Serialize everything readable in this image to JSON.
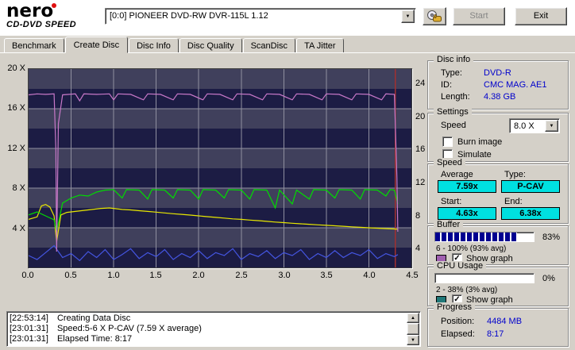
{
  "header": {
    "logo_line1": "nero",
    "logo_line2": "CD-DVD SPEED",
    "device_selector": "[0:0] PIONEER DVD-RW DVR-115L 1.12",
    "start_label": "Start",
    "exit_label": "Exit"
  },
  "tabs": [
    {
      "label": "Benchmark"
    },
    {
      "label": "Create Disc"
    },
    {
      "label": "Disc Info"
    },
    {
      "label": "Disc Quality"
    },
    {
      "label": "ScanDisc"
    },
    {
      "label": "TA Jitter"
    }
  ],
  "chart": {
    "type": "line",
    "x_max": 4.5,
    "y_max": 20,
    "x_ticks": [
      "0.0",
      "0.5",
      "1.0",
      "1.5",
      "2.0",
      "2.5",
      "3.0",
      "3.5",
      "4.0",
      "4.5"
    ],
    "y_left_ticks": [
      "20 X",
      "16 X",
      "12 X",
      "8 X",
      "4 X"
    ],
    "y_right_ticks": [
      "24",
      "20",
      "16",
      "12",
      "8",
      "4"
    ],
    "end_marker_x": 4.31,
    "colors": {
      "band_light": "#40405c",
      "band_dark": "#1c1c44",
      "grid": "#9090a0",
      "marker": "#a03030",
      "buffer": "#c878c8",
      "rpm": "#e8e800",
      "write": "#00dc00",
      "cpu": "#4455e0"
    },
    "series": {
      "buffer": [
        [
          0,
          17.4
        ],
        [
          0.1,
          17.5
        ],
        [
          0.2,
          17.45
        ],
        [
          0.3,
          17.5
        ],
        [
          0.32,
          12
        ],
        [
          0.33,
          1.6
        ],
        [
          0.35,
          14.5
        ],
        [
          0.4,
          17.4
        ],
        [
          0.55,
          17.5
        ],
        [
          0.6,
          16.8
        ],
        [
          0.65,
          17.5
        ],
        [
          0.8,
          17.45
        ],
        [
          0.95,
          17.5
        ],
        [
          1.0,
          16.9
        ],
        [
          1.05,
          17.5
        ],
        [
          1.2,
          17.45
        ],
        [
          1.35,
          16.9
        ],
        [
          1.4,
          17.5
        ],
        [
          1.55,
          17.45
        ],
        [
          1.7,
          16.9
        ],
        [
          1.75,
          17.5
        ],
        [
          1.9,
          17.45
        ],
        [
          2.05,
          16.9
        ],
        [
          2.1,
          17.5
        ],
        [
          2.25,
          17.45
        ],
        [
          2.4,
          16.9
        ],
        [
          2.45,
          17.5
        ],
        [
          2.6,
          17.45
        ],
        [
          2.75,
          16.9
        ],
        [
          2.8,
          17.5
        ],
        [
          2.95,
          17.45
        ],
        [
          3.1,
          16.9
        ],
        [
          3.15,
          17.5
        ],
        [
          3.3,
          17.45
        ],
        [
          3.45,
          16.9
        ],
        [
          3.5,
          17.5
        ],
        [
          3.65,
          17.45
        ],
        [
          3.8,
          16.9
        ],
        [
          3.85,
          17.5
        ],
        [
          4.0,
          17.45
        ],
        [
          4.15,
          16.9
        ],
        [
          4.2,
          17.5
        ],
        [
          4.3,
          17.45
        ],
        [
          4.33,
          9.0
        ],
        [
          4.34,
          3.6
        ]
      ],
      "write": [
        [
          0,
          5.3
        ],
        [
          0.1,
          5.6
        ],
        [
          0.2,
          5.2
        ],
        [
          0.3,
          4.8
        ],
        [
          0.33,
          3.6
        ],
        [
          0.4,
          6.5
        ],
        [
          0.5,
          7.0
        ],
        [
          0.6,
          7.3
        ],
        [
          0.7,
          7.2
        ],
        [
          0.8,
          7.6
        ],
        [
          0.9,
          7.8
        ],
        [
          1.0,
          7.85
        ],
        [
          1.1,
          7.0
        ],
        [
          1.15,
          7.85
        ],
        [
          1.3,
          7.8
        ],
        [
          1.4,
          6.9
        ],
        [
          1.45,
          7.85
        ],
        [
          1.6,
          7.8
        ],
        [
          1.7,
          7.0
        ],
        [
          1.75,
          7.85
        ],
        [
          1.9,
          7.8
        ],
        [
          2.0,
          6.9
        ],
        [
          2.05,
          7.85
        ],
        [
          2.2,
          7.8
        ],
        [
          2.3,
          7.0
        ],
        [
          2.35,
          7.85
        ],
        [
          2.5,
          7.8
        ],
        [
          2.6,
          6.9
        ],
        [
          2.65,
          7.85
        ],
        [
          2.8,
          7.8
        ],
        [
          2.9,
          6.0
        ],
        [
          2.95,
          7.8
        ],
        [
          3.1,
          6.4
        ],
        [
          3.15,
          7.8
        ],
        [
          3.3,
          6.9
        ],
        [
          3.35,
          7.85
        ],
        [
          3.5,
          7.8
        ],
        [
          3.6,
          7.0
        ],
        [
          3.65,
          7.85
        ],
        [
          3.8,
          7.8
        ],
        [
          3.9,
          6.9
        ],
        [
          3.95,
          7.85
        ],
        [
          4.1,
          7.8
        ],
        [
          4.2,
          7.2
        ],
        [
          4.25,
          7.85
        ],
        [
          4.3,
          7.8
        ],
        [
          4.34,
          6.4
        ]
      ],
      "rpm": [
        [
          0,
          4.85
        ],
        [
          0.1,
          5.1
        ],
        [
          0.15,
          6.2
        ],
        [
          0.2,
          6.35
        ],
        [
          0.25,
          6.1
        ],
        [
          0.3,
          5.2
        ],
        [
          0.33,
          2.6
        ],
        [
          0.38,
          5.3
        ],
        [
          0.45,
          5.55
        ],
        [
          0.55,
          5.65
        ],
        [
          0.65,
          5.75
        ],
        [
          0.75,
          5.85
        ],
        [
          0.85,
          5.95
        ],
        [
          0.95,
          6.0
        ],
        [
          1.0,
          5.95
        ],
        [
          1.1,
          5.85
        ],
        [
          1.2,
          5.8
        ],
        [
          1.3,
          5.72
        ],
        [
          1.4,
          5.65
        ],
        [
          1.5,
          5.58
        ],
        [
          1.6,
          5.5
        ],
        [
          1.7,
          5.42
        ],
        [
          1.8,
          5.35
        ],
        [
          1.9,
          5.28
        ],
        [
          2.0,
          5.2
        ],
        [
          2.1,
          5.12
        ],
        [
          2.2,
          5.05
        ],
        [
          2.3,
          4.98
        ],
        [
          2.4,
          4.9
        ],
        [
          2.5,
          4.85
        ],
        [
          2.6,
          4.78
        ],
        [
          2.7,
          4.72
        ],
        [
          2.8,
          4.65
        ],
        [
          2.9,
          4.58
        ],
        [
          3.0,
          4.52
        ],
        [
          3.1,
          4.46
        ],
        [
          3.2,
          4.4
        ],
        [
          3.3,
          4.35
        ],
        [
          3.4,
          4.3
        ],
        [
          3.5,
          4.25
        ],
        [
          3.6,
          4.2
        ],
        [
          3.7,
          4.15
        ],
        [
          3.8,
          4.1
        ],
        [
          3.9,
          4.05
        ],
        [
          4.0,
          4.0
        ],
        [
          4.1,
          3.96
        ],
        [
          4.2,
          3.92
        ],
        [
          4.3,
          3.88
        ],
        [
          4.34,
          3.85
        ]
      ],
      "cpu": [
        [
          0,
          1.2
        ],
        [
          0.1,
          0.8
        ],
        [
          0.2,
          1.5
        ],
        [
          0.3,
          2.2
        ],
        [
          0.4,
          1.0
        ],
        [
          0.5,
          1.4
        ],
        [
          0.6,
          0.7
        ],
        [
          0.7,
          1.6
        ],
        [
          0.8,
          1.0
        ],
        [
          0.9,
          1.8
        ],
        [
          1.0,
          0.8
        ],
        [
          1.1,
          1.3
        ],
        [
          1.2,
          1.9
        ],
        [
          1.3,
          0.9
        ],
        [
          1.4,
          1.5
        ],
        [
          1.5,
          1.1
        ],
        [
          1.6,
          1.8
        ],
        [
          1.7,
          0.8
        ],
        [
          1.8,
          1.4
        ],
        [
          1.9,
          1.0
        ],
        [
          2.0,
          1.7
        ],
        [
          2.1,
          0.9
        ],
        [
          2.2,
          1.5
        ],
        [
          2.3,
          1.2
        ],
        [
          2.4,
          1.9
        ],
        [
          2.5,
          0.8
        ],
        [
          2.6,
          1.4
        ],
        [
          2.7,
          1.1
        ],
        [
          2.8,
          1.7
        ],
        [
          2.9,
          0.9
        ],
        [
          3.0,
          1.5
        ],
        [
          3.1,
          1.2
        ],
        [
          3.2,
          1.8
        ],
        [
          3.3,
          0.8
        ],
        [
          3.4,
          1.4
        ],
        [
          3.5,
          1.0
        ],
        [
          3.6,
          1.7
        ],
        [
          3.7,
          1.0
        ],
        [
          3.8,
          1.5
        ],
        [
          3.9,
          1.2
        ],
        [
          4.0,
          1.8
        ],
        [
          4.1,
          0.9
        ],
        [
          4.2,
          1.4
        ],
        [
          4.3,
          1.1
        ],
        [
          4.34,
          1.3
        ]
      ]
    }
  },
  "disc_info": {
    "title": "Disc info",
    "type_label": "Type:",
    "type": "DVD-R",
    "id_label": "ID:",
    "id": "CMC MAG. AE1",
    "length_label": "Length:",
    "length": "4.38 GB"
  },
  "settings": {
    "title": "Settings",
    "speed_label": "Speed",
    "speed_value": "8.0 X",
    "burn_image_label": "Burn image",
    "burn_image_check": "",
    "simulate_label": "Simulate",
    "simulate_check": ""
  },
  "speed": {
    "title": "Speed",
    "average_label": "Average",
    "average": "7.59x",
    "type_label": "Type:",
    "type": "P-CAV",
    "start_label": "Start:",
    "start": "4.63x",
    "end_label": "End:",
    "end": "6.38x"
  },
  "buffer": {
    "title": "Buffer",
    "percent": "83%",
    "fill": 83,
    "range": "6 - 100% (93% avg)",
    "show_graph_label": "Show graph",
    "check": "✓",
    "swatch": "#a060b0"
  },
  "cpu": {
    "title": "CPU Usage",
    "percent": "0%",
    "fill": 0,
    "range": "2 - 38% (3% avg)",
    "show_graph_label": "Show graph",
    "check": "✓",
    "swatch": "#207878"
  },
  "progress": {
    "title": "Progress",
    "position_label": "Position:",
    "position": "4484 MB",
    "elapsed_label": "Elapsed:",
    "elapsed": "8:17"
  },
  "log": [
    {
      "time": "[22:53:14]",
      "text": "Creating Data Disc"
    },
    {
      "time": "[23:01:31]",
      "text": "Speed:5-6 X P-CAV (7.59 X average)"
    },
    {
      "time": "[23:01:31]",
      "text": "Elapsed Time: 8:17"
    }
  ]
}
